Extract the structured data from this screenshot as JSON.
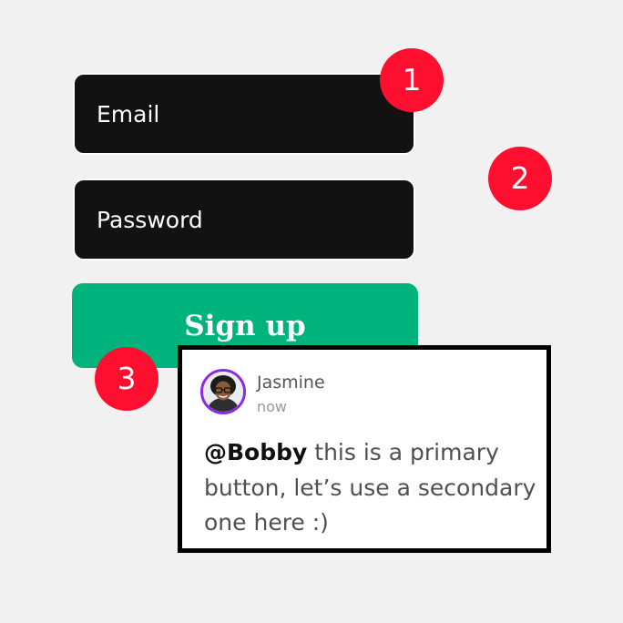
{
  "form": {
    "email_label": "Email",
    "password_label": "Password",
    "signup_label": "Sign up"
  },
  "markers": [
    "1",
    "2",
    "3"
  ],
  "comment": {
    "author": "Jasmine",
    "time": "now",
    "mention": "@Bobby",
    "text": " this is a primary button, let’s use a secondary one here :)"
  },
  "colors": {
    "background": "#f1f1f1",
    "field_background": "#121212",
    "primary_button": "#00b27b",
    "marker": "#ff0f2f",
    "avatar_ring": "#8a2be2"
  },
  "icons": {
    "avatar": "user-avatar-photo"
  }
}
